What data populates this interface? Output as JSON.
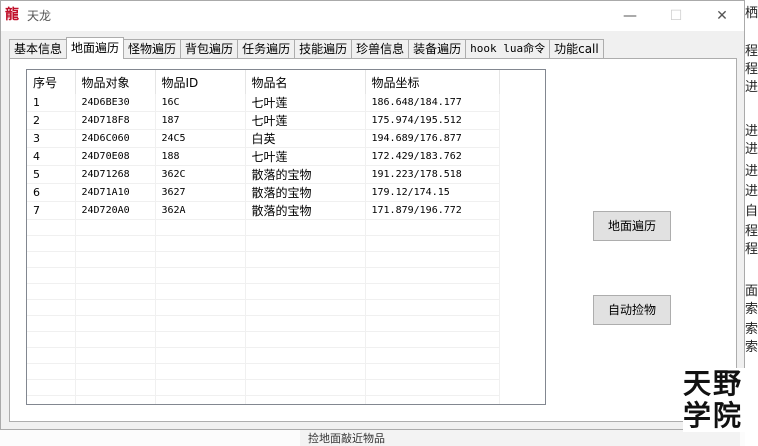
{
  "window": {
    "title": "天龙",
    "app_icon_glyph": "龍"
  },
  "tabs": [
    {
      "label": "基本信息"
    },
    {
      "label": "地面遍历",
      "active": true
    },
    {
      "label": "怪物遍历"
    },
    {
      "label": "背包遍历"
    },
    {
      "label": "任务遍历"
    },
    {
      "label": "技能遍历"
    },
    {
      "label": "珍兽信息"
    },
    {
      "label": "装备遍历"
    },
    {
      "label": "hook lua命令"
    },
    {
      "label": "功能call"
    }
  ],
  "table": {
    "headers": [
      "序号",
      "物品对象",
      "物品ID",
      "物品名",
      "物品坐标"
    ],
    "rows": [
      [
        "1",
        "24D6BE30",
        "16C",
        "七叶莲",
        "186.648/184.177"
      ],
      [
        "2",
        "24D718F8",
        "187",
        "七叶莲",
        "175.974/195.512"
      ],
      [
        "3",
        "24D6C060",
        "24C5",
        "白英",
        "194.689/176.877"
      ],
      [
        "4",
        "24D70E08",
        "188",
        "七叶莲",
        "172.429/183.762"
      ],
      [
        "5",
        "24D71268",
        "362C",
        "散落的宝物",
        "191.223/178.518"
      ],
      [
        "6",
        "24D71A10",
        "3627",
        "散落的宝物",
        "179.12/174.15"
      ],
      [
        "7",
        "24D720A0",
        "362A",
        "散落的宝物",
        "171.879/196.772"
      ]
    ]
  },
  "buttons": {
    "ground_traverse": "地面遍历",
    "auto_pickup": "自动捡物"
  },
  "watermark": {
    "line1": "天野",
    "line2": "学院"
  },
  "background": {
    "right_chars": [
      "栖",
      "程",
      "程",
      "进程",
      "进",
      "进",
      "进",
      "进",
      "自",
      "程",
      "程",
      "面",
      "索",
      "索",
      "索"
    ],
    "bottom_text": "捡地面敲近物品"
  }
}
